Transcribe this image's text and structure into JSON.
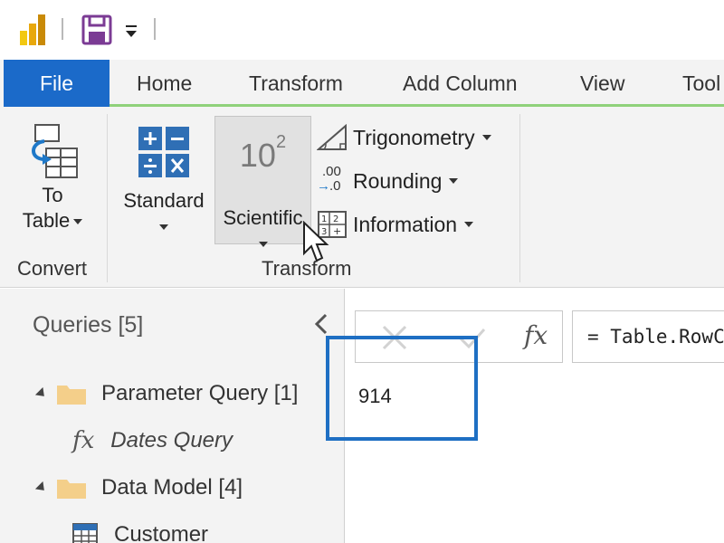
{
  "quick_access": {
    "logo_icon": "powerbi-logo-icon",
    "save_icon": "save-icon",
    "customize_icon": "customize-dropdown-icon"
  },
  "tabs": [
    {
      "label": "File",
      "active": true
    },
    {
      "label": "Home"
    },
    {
      "label": "Transform"
    },
    {
      "label": "Add Column"
    },
    {
      "label": "View"
    },
    {
      "label": "Tool"
    }
  ],
  "ribbon": {
    "convert": {
      "group_label": "Convert",
      "to_table": {
        "line1": "To",
        "line2": "Table"
      }
    },
    "transform": {
      "group_label": "Transform",
      "standard": {
        "label": "Standard"
      },
      "scientific": {
        "label": "Scientific",
        "icon_base": "10",
        "icon_exp": "2"
      },
      "trigonometry": {
        "label": "Trigonometry"
      },
      "rounding": {
        "label": "Rounding",
        "icon_top": ".00",
        "icon_bottom": ".0"
      },
      "information": {
        "label": "Information"
      }
    }
  },
  "queries": {
    "title": "Queries [5]",
    "items": [
      {
        "label": "Parameter Query [1]",
        "type": "folder"
      },
      {
        "label": "Dates Query",
        "type": "function",
        "icon_text": "fx"
      },
      {
        "label": "Data Model [4]",
        "type": "folder"
      },
      {
        "label": "Customer",
        "type": "table"
      }
    ]
  },
  "formula_bar": {
    "fx_label": "fx",
    "formula": "= Table.RowCount"
  },
  "result": {
    "value": "914"
  },
  "colors": {
    "file_tab": "#1b6ac9",
    "accent_green": "#8fd17a",
    "highlight": "#1e6fc3",
    "ribbon_bg": "#f3f3f3",
    "folder": "#f4cf8a",
    "save_purple": "#7b3b94"
  }
}
